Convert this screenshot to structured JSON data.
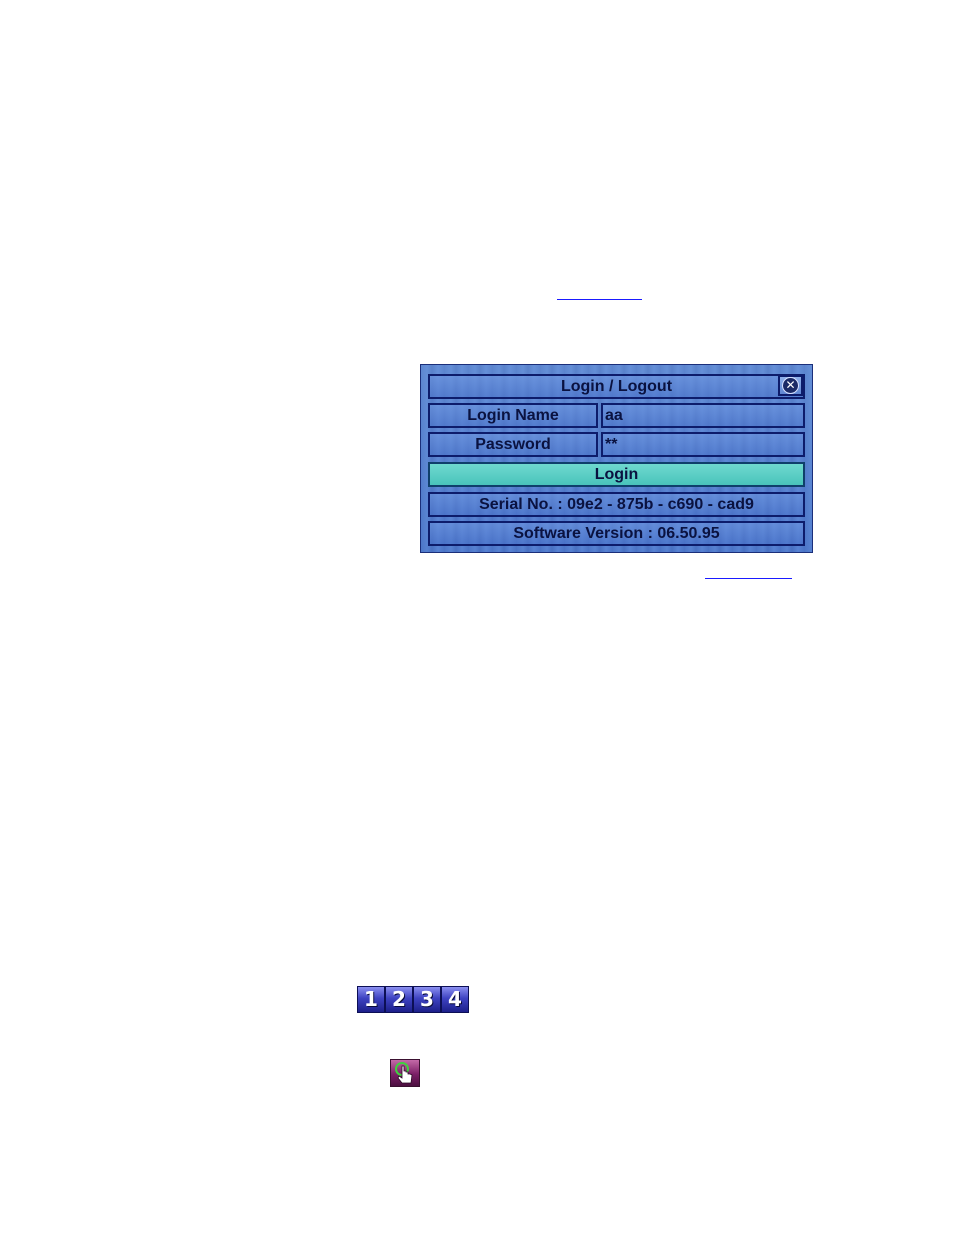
{
  "dialog": {
    "title": "Login / Logout",
    "login_name_label": "Login Name",
    "login_name_value": "aa",
    "password_label": "Password",
    "password_value": "**",
    "login_button": "Login",
    "serial": "Serial No. : 09e2 - 875b - c690 - cad9",
    "software_version": "Software Version : 06.50.95"
  },
  "split_buttons": [
    "1",
    "2",
    "3",
    "4"
  ],
  "icons": {
    "close": "close-icon",
    "hand": "hand-pointer-icon"
  },
  "colors": {
    "dialog_bg": "#5580cf",
    "login_button": "#56cfc5",
    "split_button": "#3e43c2",
    "hand_icon": "#7b1f66"
  }
}
